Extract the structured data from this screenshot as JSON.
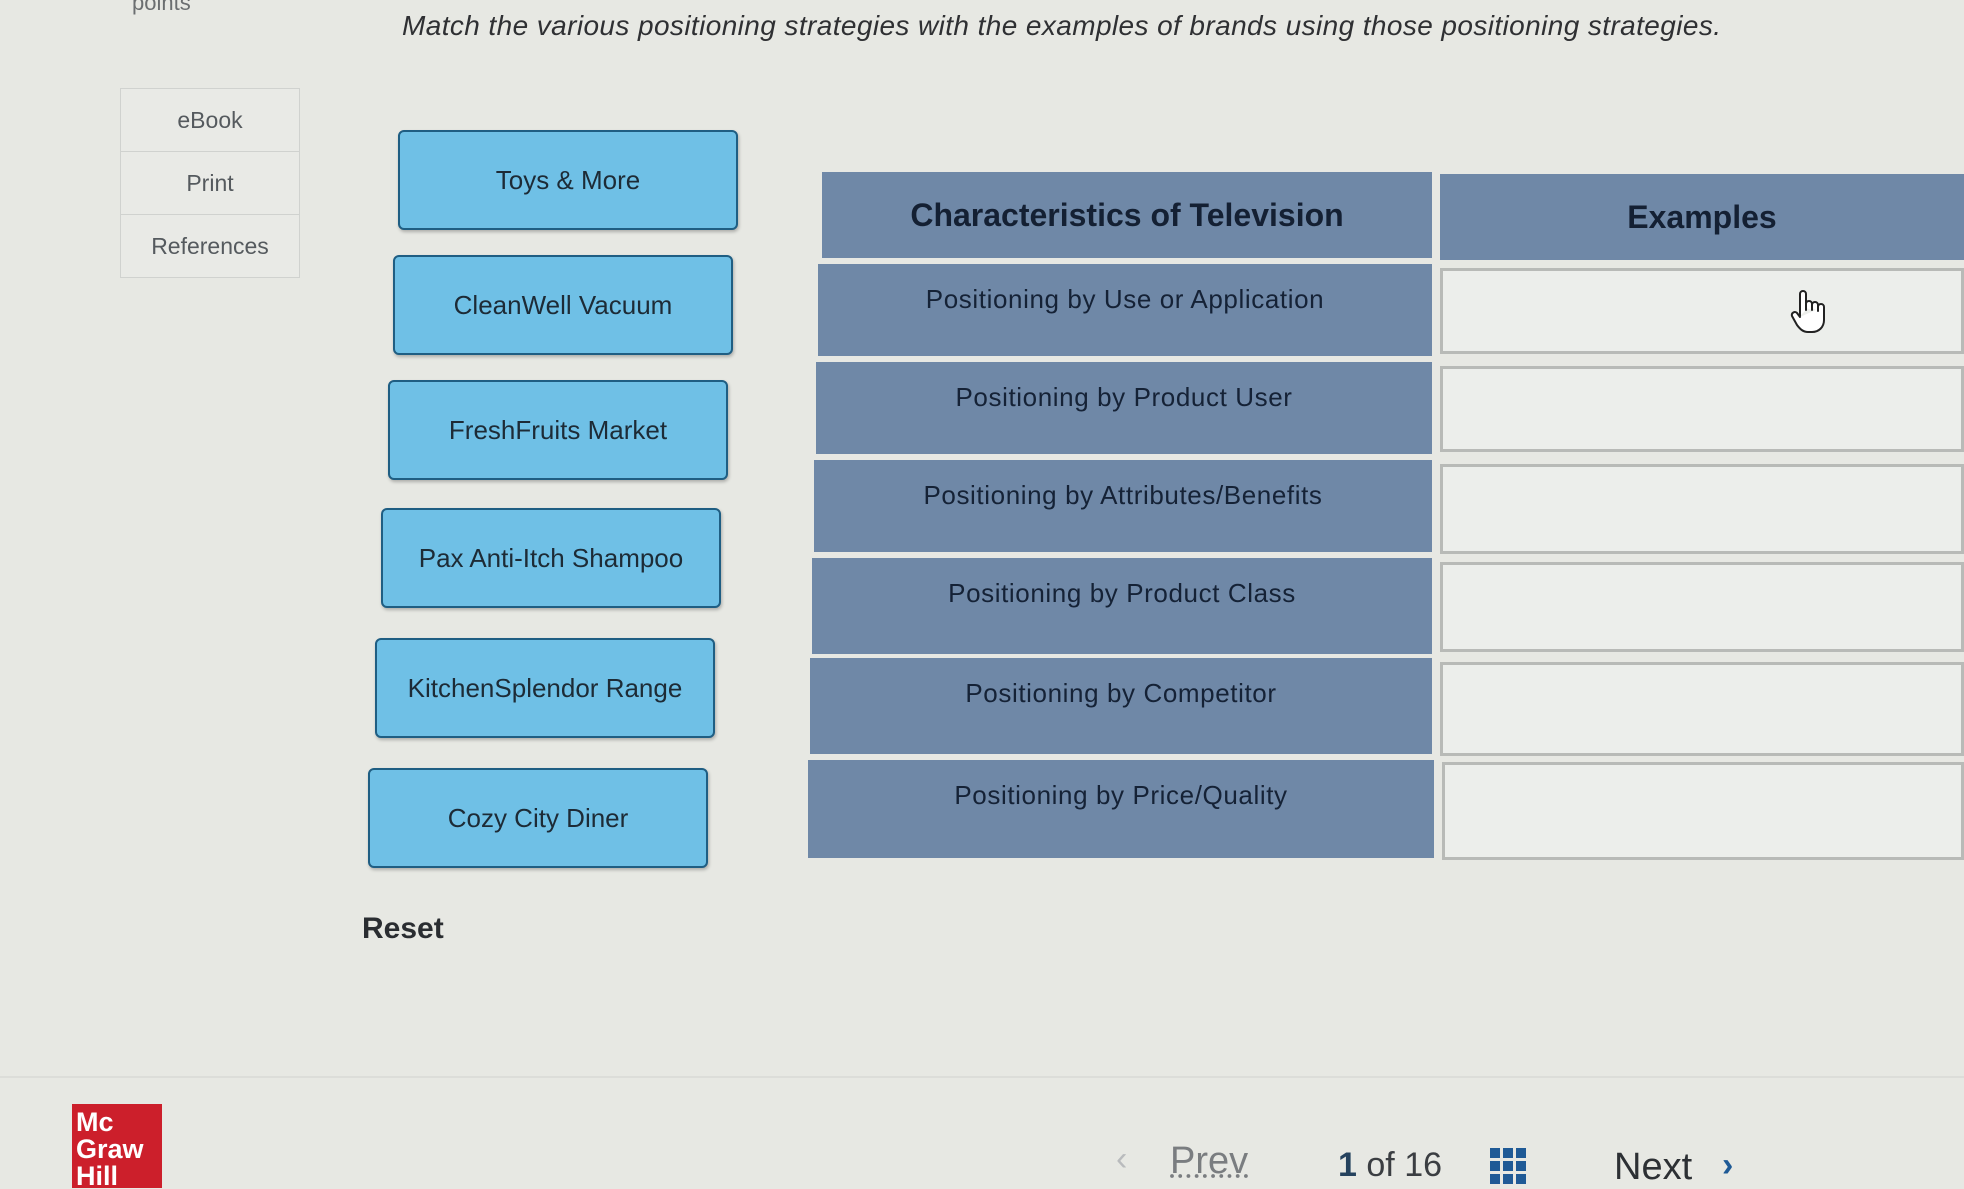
{
  "header": {
    "points_label": "points",
    "instructions": "Match the various positioning strategies with the examples of brands using those positioning strategies."
  },
  "side_tools": [
    "eBook",
    "Print",
    "References"
  ],
  "draggables": [
    "Toys & More",
    "CleanWell Vacuum",
    "FreshFruits Market",
    "Pax Anti-Itch Shampoo",
    "KitchenSplendor Range",
    "Cozy City Diner"
  ],
  "table": {
    "col1_header": "Characteristics of Television",
    "col2_header": "Examples",
    "rows": [
      "Positioning by Use or Application",
      "Positioning by Product User",
      "Positioning by Attributes/Benefits",
      "Positioning by Product Class",
      "Positioning by Competitor",
      "Positioning by Price/Quality"
    ]
  },
  "reset_label": "Reset",
  "logo": [
    "Mc",
    "Graw",
    "Hill"
  ],
  "footer": {
    "prev_label": "Prev",
    "current_page": "1",
    "of_label": "of",
    "total_pages": "16",
    "next_label": "Next"
  },
  "icons": {
    "hand": "hand-pointer-icon",
    "grid": "grid-icon",
    "prev": "chevron-left-icon",
    "next": "chevron-right-icon"
  },
  "colors": {
    "draggable_bg": "#6fc0e6",
    "table_header_bg": "#6f88a7",
    "logo_red": "#cc1f2b",
    "next_chevron": "#1f5a96"
  }
}
